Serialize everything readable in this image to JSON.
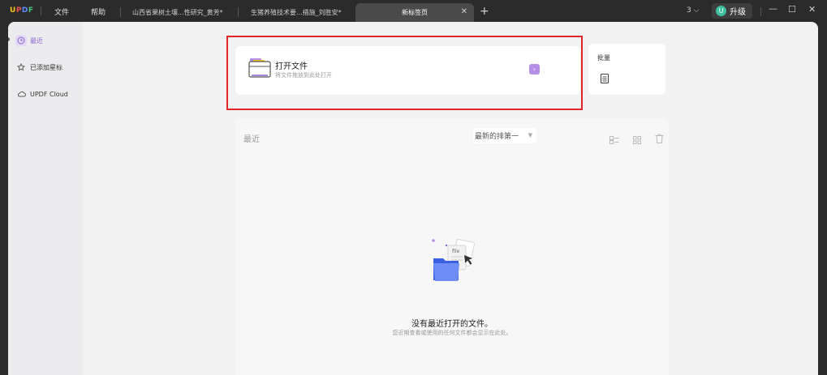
{
  "titlebar": {
    "logo": "UPDF",
    "menu": [
      "文件",
      "帮助"
    ],
    "tabs": [
      {
        "label": "山西省果树土壤...性研究_黄芳*"
      },
      {
        "label": "生猪养殖技术要...措施_刘胜安*"
      },
      {
        "label": "新标签页"
      }
    ],
    "new_tab_icon": "plus-icon",
    "count": "3",
    "avatar_letter": "U",
    "upgrade_label": "升级"
  },
  "sidebar": {
    "items": [
      {
        "label": "最近",
        "icon": "clock-icon"
      },
      {
        "label": "已添加星标",
        "icon": "star-icon"
      },
      {
        "label": "UPDF Cloud",
        "icon": "cloud-icon"
      }
    ]
  },
  "open_file": {
    "title": "打开文件",
    "subtitle": "将文件拖放到此处打开"
  },
  "batch": {
    "title": "批量"
  },
  "recent": {
    "title": "最近",
    "sort_label": "最新的排第一"
  },
  "empty_state": {
    "title": "没有最近打开的文件。",
    "subtitle": "您近期查看或使用的任何文件都会显示在此处。"
  },
  "colors": {
    "accent": "#8a63d2",
    "highlight_box": "#e0252a"
  }
}
